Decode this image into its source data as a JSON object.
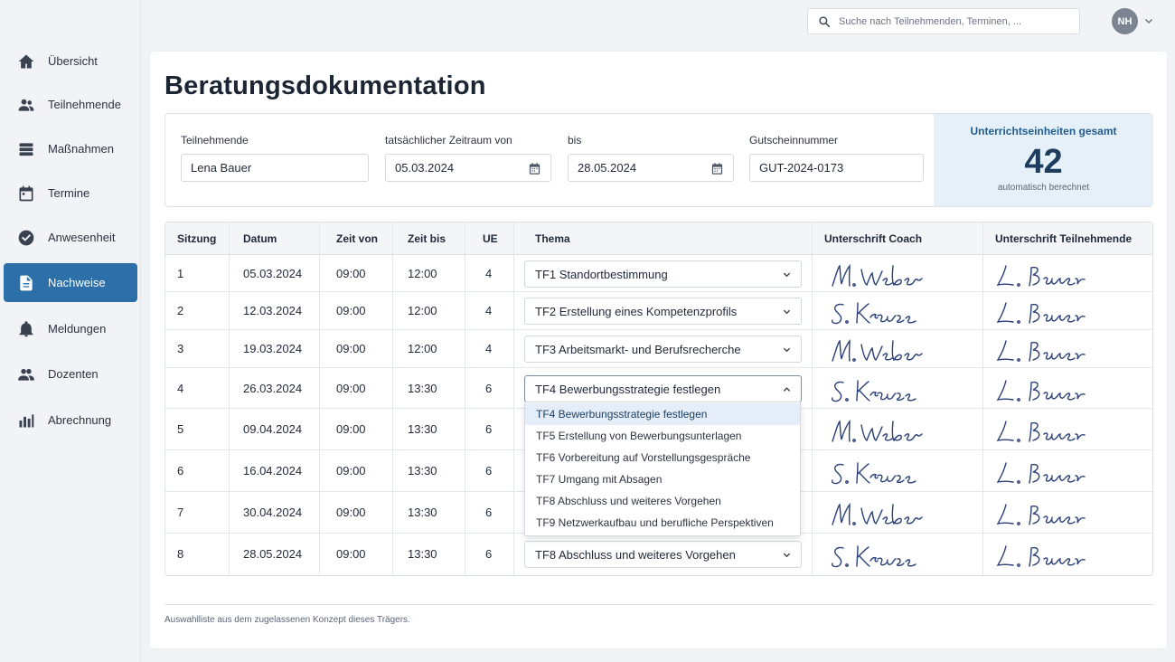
{
  "sidebar": {
    "items": [
      {
        "label": "Übersicht",
        "icon": "home-icon",
        "active": false
      },
      {
        "label": "Teilnehmende",
        "icon": "people-icon",
        "active": false
      },
      {
        "label": "Maßnahmen",
        "icon": "stack-icon",
        "active": false
      },
      {
        "label": "Termine",
        "icon": "calendar-icon",
        "active": false
      },
      {
        "label": "Anwesenheit",
        "icon": "check-circle-icon",
        "active": false
      },
      {
        "label": "Nachweise",
        "icon": "document-icon",
        "active": true
      },
      {
        "label": "Meldungen",
        "icon": "bell-icon",
        "active": false
      },
      {
        "label": "Dozenten",
        "icon": "group-icon",
        "active": false
      },
      {
        "label": "Abrechnung",
        "icon": "bar-chart-icon",
        "active": false
      }
    ]
  },
  "topbar": {
    "search_placeholder": "Suche nach Teilnehmenden, Terminen, ...",
    "avatar_initials": "NH"
  },
  "page": {
    "title": "Beratungsdokumentation"
  },
  "form": {
    "participant_label": "Teilnehmende",
    "participant_value": "Lena Bauer",
    "from_label": "tatsächlicher Zeitraum von",
    "from_value": "05.03.2024",
    "to_label": "bis",
    "to_value": "28.05.2024",
    "voucher_label": "Gutscheinnummer",
    "voucher_value": "GUT-2024-0173",
    "ue_title": "Unterrichtseinheiten gesamt",
    "ue_value": "42",
    "ue_sub": "automatisch berechnet"
  },
  "table": {
    "headers": [
      "Sitzung",
      "Datum",
      "Zeit von",
      "Zeit bis",
      "UE",
      "Thema",
      "Unterschrift Coach",
      "Unterschrift Teilnehmende"
    ],
    "rows": [
      {
        "session": "1",
        "date": "05.03.2024",
        "from": "09:00",
        "to": "12:00",
        "ue": "4",
        "topic": "TF1 Standortbestimmung",
        "coach": "M. Weber",
        "participant": "L. Bauer"
      },
      {
        "session": "2",
        "date": "12.03.2024",
        "from": "09:00",
        "to": "12:00",
        "ue": "4",
        "topic": "TF2 Erstellung eines Kompetenzprofils",
        "coach": "S. Krause",
        "participant": "L. Bauer"
      },
      {
        "session": "3",
        "date": "19.03.2024",
        "from": "09:00",
        "to": "12:00",
        "ue": "4",
        "topic": "TF3 Arbeitsmarkt- und Berufsrecherche",
        "coach": "M. Weber",
        "participant": "L. Bauer"
      },
      {
        "session": "4",
        "date": "26.03.2024",
        "from": "09:00",
        "to": "13:30",
        "ue": "6",
        "topic": "TF4 Bewerbungsstrategie festlegen",
        "coach": "S. Krause",
        "participant": "L. Bauer"
      },
      {
        "session": "5",
        "date": "09.04.2024",
        "from": "09:00",
        "to": "13:30",
        "ue": "6",
        "topic": "",
        "coach": "M. Weber",
        "participant": "L. Bauer"
      },
      {
        "session": "6",
        "date": "16.04.2024",
        "from": "09:00",
        "to": "13:30",
        "ue": "6",
        "topic": "",
        "coach": "S. Krause",
        "participant": "L. Bauer"
      },
      {
        "session": "7",
        "date": "30.04.2024",
        "from": "09:00",
        "to": "13:30",
        "ue": "6",
        "topic": "",
        "coach": "M. Weber",
        "participant": "L. Bauer"
      },
      {
        "session": "8",
        "date": "28.05.2024",
        "from": "09:00",
        "to": "13:30",
        "ue": "6",
        "topic": "TF8 Abschluss und weiteres Vorgehen",
        "coach": "S. Krause",
        "participant": "L. Bauer"
      }
    ]
  },
  "dropdown": {
    "options": [
      "TF4 Bewerbungsstrategie festlegen",
      "TF5 Erstellung von Bewerbungsunterlagen",
      "TF6 Vorbereitung auf Vorstellungsgespräche",
      "TF7 Umgang mit Absagen",
      "TF8 Abschluss und weiteres Vorgehen",
      "TF9 Netzwerkaufbau und berufliche Perspektiven"
    ],
    "highlighted": "TF4 Bewerbungsstrategie festlegen"
  },
  "footer": {
    "note": "Auswahlliste aus dem zugelassenen Konzept dieses Trägers."
  },
  "colors": {
    "accent": "#2d6fa8",
    "signature_ink": "#2a3f78",
    "ue_panel": "#e6f0f8"
  }
}
